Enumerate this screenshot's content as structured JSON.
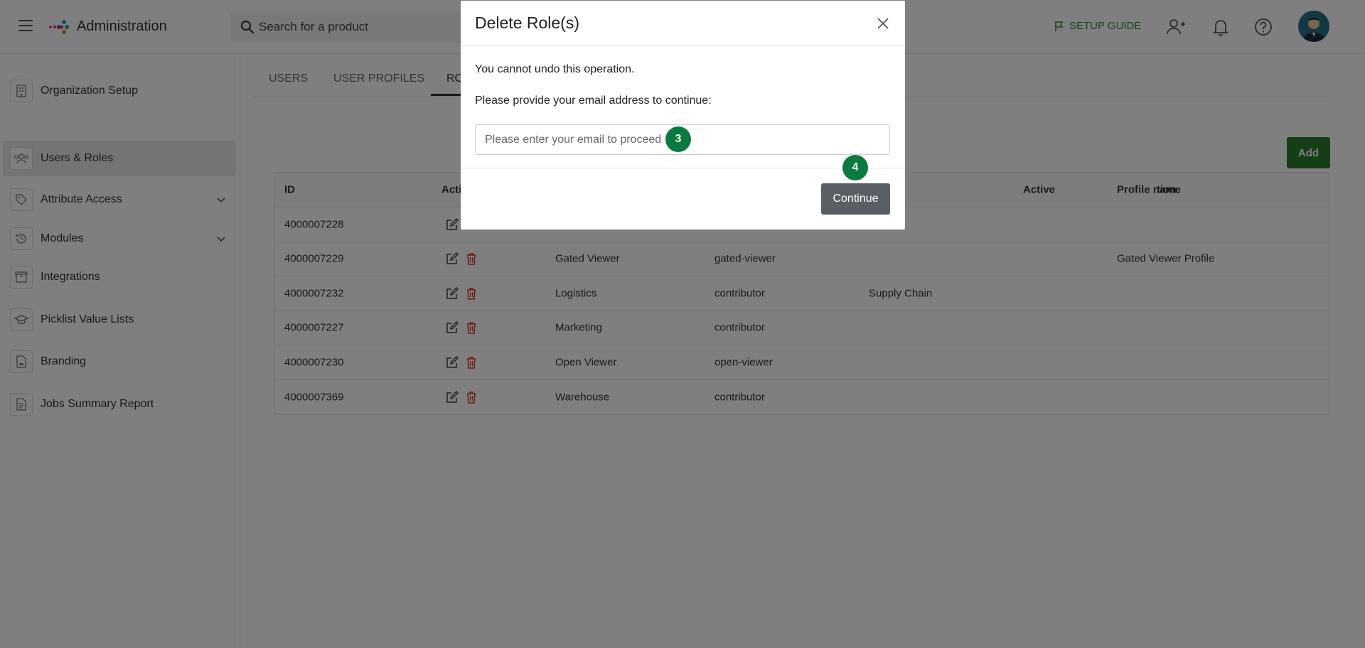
{
  "header": {
    "app_title": "Administration",
    "search_placeholder": "Search for a product",
    "setup_guide": "SETUP GUIDE"
  },
  "sidebar": {
    "items": [
      {
        "label": "Organization Setup",
        "icon": "building-icon"
      },
      {
        "label": "Users & Roles",
        "icon": "users-icon",
        "active": true
      },
      {
        "label": "Attribute Access",
        "icon": "tag-icon",
        "expandable": true
      },
      {
        "label": "Modules",
        "icon": "history-icon",
        "expandable": true
      },
      {
        "label": "Integrations",
        "icon": "box-icon"
      },
      {
        "label": "Picklist Value Lists",
        "icon": "graduation-cap-icon"
      },
      {
        "label": "Branding",
        "icon": "file-image-icon"
      },
      {
        "label": "Jobs Summary Report",
        "icon": "document-icon"
      }
    ]
  },
  "tabs": [
    {
      "label": "USERS"
    },
    {
      "label": "USER PROFILES"
    },
    {
      "label": "RO",
      "active": true
    }
  ],
  "add_button": "Add",
  "table": {
    "columns": [
      "ID",
      "Acti",
      "",
      "",
      "tion",
      "Active",
      "Profile name"
    ],
    "rows": [
      {
        "id": "4000007228",
        "name": "",
        "role": "",
        "location": "",
        "active": "",
        "profile": ""
      },
      {
        "id": "4000007229",
        "name": "Gated Viewer",
        "role": "gated-viewer",
        "location": "",
        "active": "",
        "profile": "Gated Viewer Profile"
      },
      {
        "id": "4000007232",
        "name": "Logistics",
        "role": "contributor",
        "location": "Supply Chain",
        "active": "",
        "profile": ""
      },
      {
        "id": "4000007227",
        "name": "Marketing",
        "role": "contributor",
        "location": "",
        "active": "",
        "profile": ""
      },
      {
        "id": "4000007230",
        "name": "Open Viewer",
        "role": "open-viewer",
        "location": "",
        "active": "",
        "profile": ""
      },
      {
        "id": "4000007369",
        "name": "Warehouse",
        "role": "contributor",
        "location": "",
        "active": "",
        "profile": ""
      }
    ]
  },
  "modal": {
    "title": "Delete Role(s)",
    "warning": "You cannot undo this operation.",
    "prompt": "Please provide your email address to continue:",
    "email_placeholder": "Please enter your email to proceed",
    "email_value": "",
    "continue_label": "Continue",
    "badge_input": "3",
    "badge_continue": "4"
  },
  "colors": {
    "accent_green": "#2a7d2e",
    "badge_green": "#0b7a3e",
    "continue_gray": "#5a5f66",
    "delete_red": "#d9342b"
  }
}
